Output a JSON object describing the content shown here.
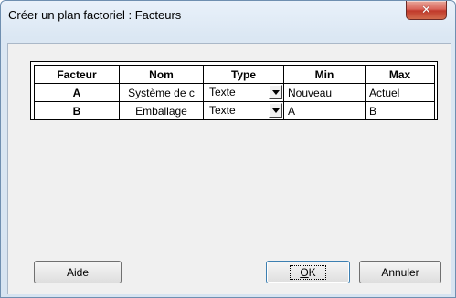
{
  "window": {
    "title": "Créer un plan factoriel : Facteurs",
    "close_glyph": "✕",
    "close_color": "#c0392b"
  },
  "grid": {
    "headers": {
      "facteur": "Facteur",
      "nom": "Nom",
      "type": "Type",
      "min": "Min",
      "max": "Max"
    },
    "rows": [
      {
        "facteur": "A",
        "nom": "Système de c",
        "type": "Texte",
        "min": "Nouveau",
        "max": "Actuel"
      },
      {
        "facteur": "B",
        "nom": "Emballage",
        "type": "Texte",
        "min": "A",
        "max": "B"
      }
    ]
  },
  "buttons": {
    "help_label": "Aide",
    "ok_mnemonic": "O",
    "ok_rest": "K",
    "cancel_label": "Annuler"
  }
}
